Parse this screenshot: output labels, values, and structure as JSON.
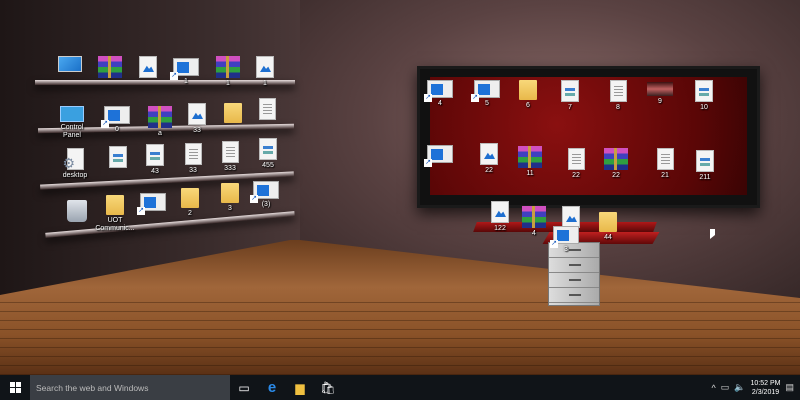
{
  "desktop_icons": [
    {
      "type": "pc",
      "label": "",
      "name": "this-pc"
    },
    {
      "type": "rar",
      "label": ""
    },
    {
      "type": "image",
      "label": ""
    },
    {
      "type": "short",
      "label": "1"
    },
    {
      "type": "rar",
      "label": "1"
    },
    {
      "type": "image",
      "label": "1"
    },
    {
      "type": "cp",
      "label": "Control Panel",
      "name": "control-panel"
    },
    {
      "type": "short",
      "label": "0"
    },
    {
      "type": "rar",
      "label": "a"
    },
    {
      "type": "image",
      "label": "33"
    },
    {
      "type": "folder",
      "label": ""
    },
    {
      "type": "doc",
      "label": ""
    },
    {
      "type": "gear",
      "label": "desktop"
    },
    {
      "type": "chart",
      "label": ""
    },
    {
      "type": "chart",
      "label": "43"
    },
    {
      "type": "doc",
      "label": "33"
    },
    {
      "type": "doc",
      "label": "333"
    },
    {
      "type": "chart",
      "label": "455"
    },
    {
      "type": "bin",
      "label": "",
      "name": "recycle-bin"
    },
    {
      "type": "folder",
      "label": "UOT Communic..."
    },
    {
      "type": "short",
      "label": ""
    },
    {
      "type": "folder",
      "label": "2"
    },
    {
      "type": "folder",
      "label": "3"
    },
    {
      "type": "short",
      "label": "(3)"
    },
    {
      "type": "short",
      "label": "4"
    },
    {
      "type": "short",
      "label": "5"
    },
    {
      "type": "folder",
      "label": "6"
    },
    {
      "type": "chart",
      "label": "7"
    },
    {
      "type": "doc",
      "label": "8"
    },
    {
      "type": "photo",
      "label": "9"
    },
    {
      "type": "chart",
      "label": "10"
    },
    {
      "type": "short",
      "label": ""
    },
    {
      "type": "image",
      "label": "22"
    },
    {
      "type": "rar",
      "label": "11"
    },
    {
      "type": "doc",
      "label": "22"
    },
    {
      "type": "rar",
      "label": "22"
    },
    {
      "type": "doc",
      "label": "21"
    },
    {
      "type": "chart",
      "label": "211"
    },
    {
      "type": "image",
      "label": "122"
    },
    {
      "type": "rar",
      "label": "4"
    },
    {
      "type": "image",
      "label": ""
    },
    {
      "type": "short",
      "label": "3"
    },
    {
      "type": "folder",
      "label": "44"
    }
  ],
  "taskbar": {
    "search_placeholder": "Search the web and Windows",
    "task_view": "▭",
    "edge": "e",
    "explorer": "▆",
    "store": "🛍",
    "tray": {
      "chevron": "^",
      "network": "▭",
      "volume": "🔈",
      "notifications": "▤"
    },
    "time": "10:52 PM",
    "date": "2/3/2019"
  }
}
